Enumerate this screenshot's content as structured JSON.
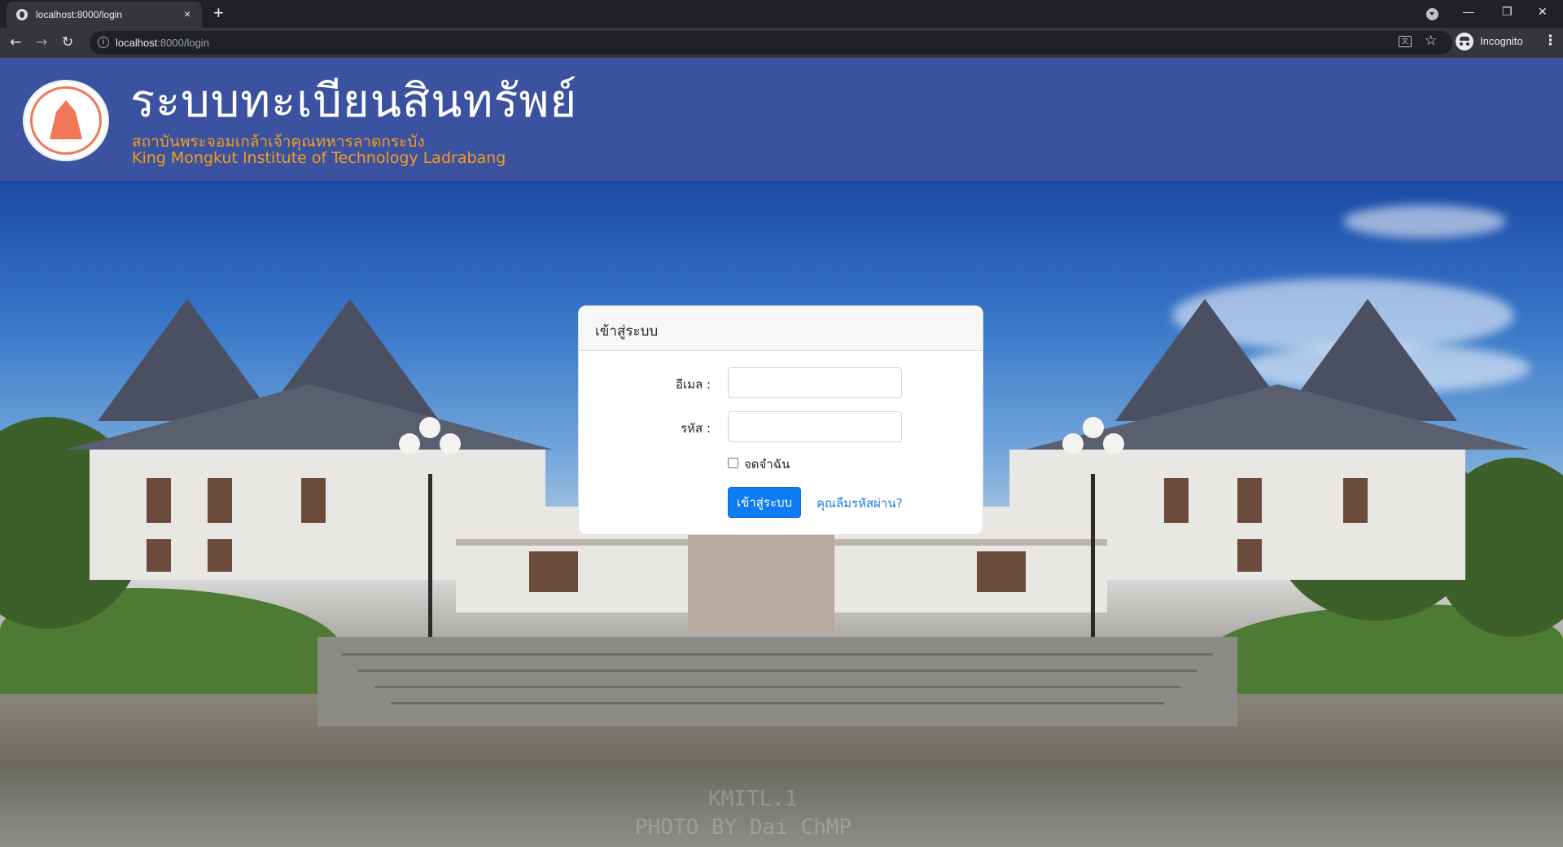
{
  "browser": {
    "tab_title": "localhost:8000/login",
    "tab_close": "×",
    "new_tab": "+",
    "url_host": "localhost",
    "url_path": ":8000/login",
    "info_glyph": "i",
    "translate_glyph": "文",
    "profile_label": "Incognito",
    "window_minimize": "—",
    "window_restore": "❐",
    "window_close": "✕",
    "back": "←",
    "forward": "→",
    "reload": "↻",
    "star": "☆",
    "menu": "⋮"
  },
  "header": {
    "title": "ระบบทะเบียนสินทรัพย์",
    "subtitle_th": "สถาบันพระจอมเกล้าเจ้าคุณทหารลาดกระบัง",
    "subtitle_en": "King Mongkut Institute of Technology Ladrabang",
    "accent_color": "#f59d1c",
    "background_color": "#3b52a1"
  },
  "login": {
    "card_title": "เข้าสู่ระบบ",
    "email_label": "อีเมล :",
    "email_value": "",
    "password_label": "รหัส :",
    "password_value": "",
    "remember_label": "จดจำฉัน",
    "remember_checked": false,
    "submit_label": "เข้าสู่ระบบ",
    "forgot_label": "คุณลืมรหัสผ่าน?",
    "button_color": "#0d7cf2"
  },
  "photo": {
    "watermark_line1": "KMITL.1",
    "watermark_line2": "PHOTO BY Dai ChMP"
  },
  "icons": [
    "globe-icon",
    "close-icon",
    "plus-icon",
    "back-icon",
    "forward-icon",
    "reload-icon",
    "info-icon",
    "translate-icon",
    "star-icon",
    "incognito-icon",
    "menu-icon",
    "tab-search-icon",
    "logo-seal"
  ]
}
